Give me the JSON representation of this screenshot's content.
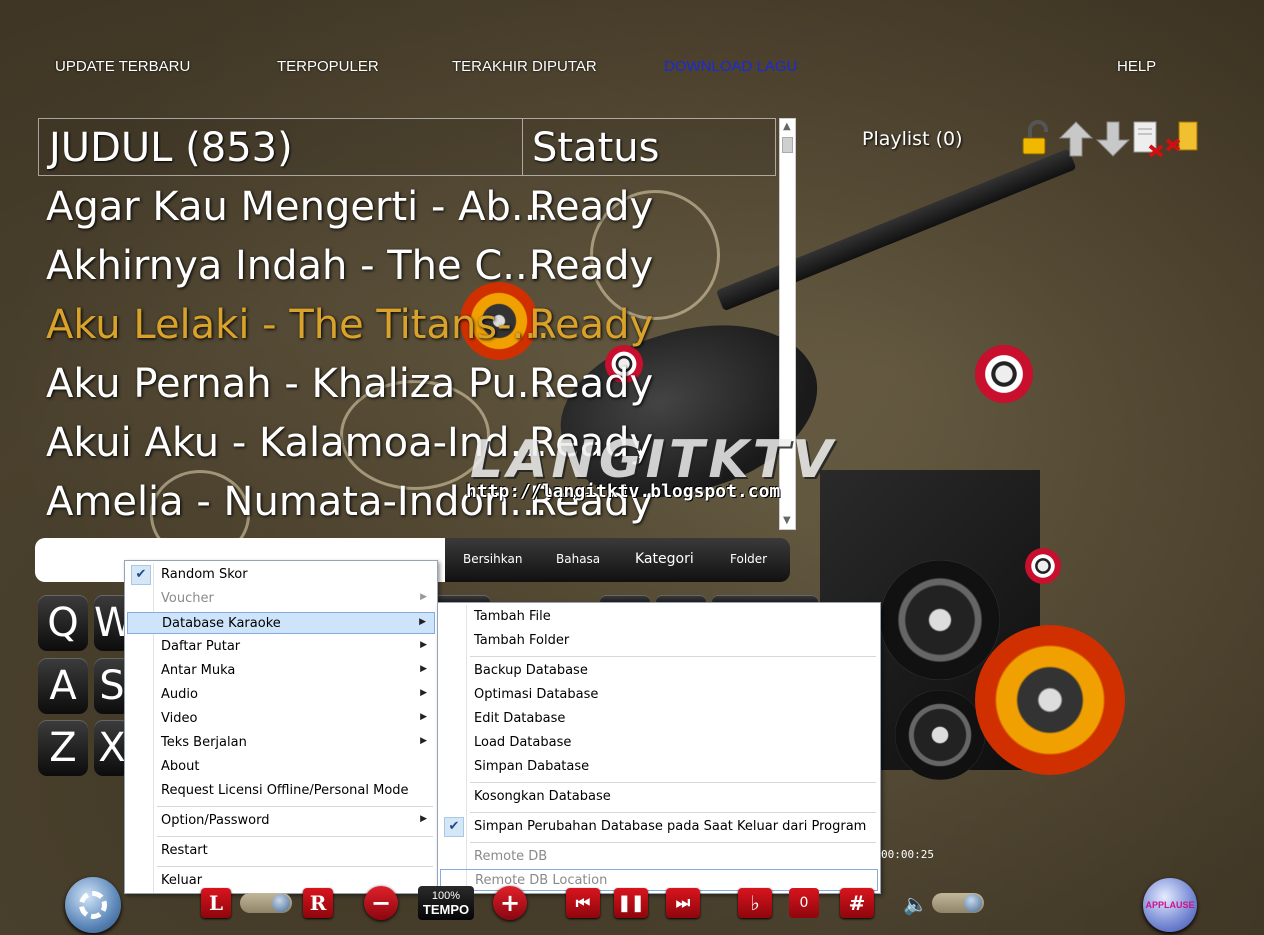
{
  "topnav": {
    "items": [
      {
        "label": "UPDATE TERBARU"
      },
      {
        "label": "TERPOPULER"
      },
      {
        "label": "TERAKHIR DIPUTAR"
      },
      {
        "label": "DOWNLOAD LAGU",
        "active": true
      },
      {
        "label": "HELP"
      }
    ]
  },
  "songlist": {
    "header": {
      "title": "JUDUL (853)",
      "status": "Status"
    },
    "rows": [
      {
        "title": "Agar Kau Mengerti - Ab...",
        "status": "Ready"
      },
      {
        "title": "Akhirnya Indah - The C...",
        "status": "Ready"
      },
      {
        "title": "Aku Lelaki - The Titans-...",
        "status": "Ready",
        "selected": true
      },
      {
        "title": "Aku Pernah - Khaliza Pu...",
        "status": "Ready"
      },
      {
        "title": "Akui Aku - Kalamoa-Ind...",
        "status": "Ready"
      },
      {
        "title": "Amelia - Numata-Indon...",
        "status": "Ready"
      }
    ]
  },
  "watermark": {
    "logo": "LANGITKTV",
    "url": "http://langitktv.blogspot.com"
  },
  "playlist": {
    "label": "Playlist (0)"
  },
  "tabs": {
    "clear": "Bersihkan",
    "language": "Bahasa",
    "category": "Kategori",
    "folder": "Folder"
  },
  "keyboard": {
    "keys": [
      "Q",
      "W",
      "A",
      "S",
      "Z",
      "X"
    ]
  },
  "context_menu": {
    "items": {
      "random_skor": "Random Skor",
      "voucher": "Voucher",
      "database_karaoke": "Database Karaoke",
      "daftar_putar": "Daftar Putar",
      "antar_muka": "Antar Muka",
      "audio": "Audio",
      "video": "Video",
      "teks_berjalan": "Teks Berjalan",
      "about": "About",
      "request_licensi": "Request Licensi Offline/Personal Mode",
      "option_password": "Option/Password",
      "restart": "Restart",
      "keluar": "Keluar"
    }
  },
  "submenu": {
    "items": {
      "tambah_file": "Tambah File",
      "tambah_folder": "Tambah Folder",
      "backup_database": "Backup Database",
      "optimasi_database": "Optimasi Database",
      "edit_database": "Edit Database",
      "load_database": "Load Database",
      "simpan_dabatase": "Simpan Dabatase",
      "kosongkan_database": "Kosongkan Database",
      "simpan_perubahan": "Simpan Perubahan Database pada Saat Keluar dari Program",
      "remote_db": "Remote DB",
      "remote_db_location": "Remote DB Location"
    }
  },
  "controls": {
    "left_channel": "L",
    "right_channel": "R",
    "tempo_percent": "100%",
    "tempo_label": "TEMPO",
    "key_flat": "♭",
    "key_value": "0",
    "key_sharp": "#",
    "time": "00:00:25",
    "applause": "APPLAUSE"
  },
  "colors": {
    "accent_selected": "#d9a22a",
    "active_nav": "#1a2ad8",
    "button_red": "#d9141e"
  }
}
